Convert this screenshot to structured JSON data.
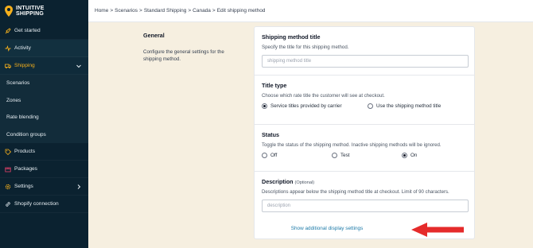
{
  "brand": {
    "line1": "INTUITIVE",
    "line2": "SHIPPING"
  },
  "colors": {
    "sidebar": "#0b2230",
    "accent": "#f5b01c",
    "link": "#1d7aa8",
    "arrow": "#e52b2b",
    "background": "#f6efe0"
  },
  "nav": {
    "items": [
      {
        "label": "Get started",
        "icon": "rocket-icon"
      },
      {
        "label": "Activity",
        "icon": "activity-icon"
      },
      {
        "label": "Shipping",
        "icon": "truck-icon"
      },
      {
        "label": "Products",
        "icon": "tag-icon"
      },
      {
        "label": "Packages",
        "icon": "package-icon"
      },
      {
        "label": "Settings",
        "icon": "gear-icon"
      },
      {
        "label": "Shopify connection",
        "icon": "link-icon"
      }
    ],
    "sub_items": [
      "Scenarios",
      "Zones",
      "Rate blending",
      "Condition groups"
    ]
  },
  "breadcrumb": [
    "Home",
    "Scenarios",
    "Standard Shipping",
    "Canada",
    "Edit shipping method"
  ],
  "general": {
    "title": "General",
    "description": "Configure the general settings for the shipping method."
  },
  "form": {
    "method_title": {
      "label": "Shipping method title",
      "help": "Specify the title for this shipping method.",
      "placeholder": "shipping method title"
    },
    "title_type": {
      "label": "Title type",
      "help": "Choose which rate title the customer will see at checkout.",
      "options": [
        "Service titles provided by carrier",
        "Use the shipping method title"
      ],
      "selected": "Service titles provided by carrier"
    },
    "status": {
      "label": "Status",
      "help": "Toggle the status of the shipping method. Inactive shipping methods will be ignored.",
      "options": [
        "Off",
        "Test",
        "On"
      ],
      "selected": "On"
    },
    "description": {
      "label": "Description",
      "optional": "(Optional)",
      "help": "Descriptions appear below the shipping method title at checkout. Limit of 90 characters.",
      "placeholder": "description"
    },
    "show_more_link": "Show additional display settings"
  }
}
